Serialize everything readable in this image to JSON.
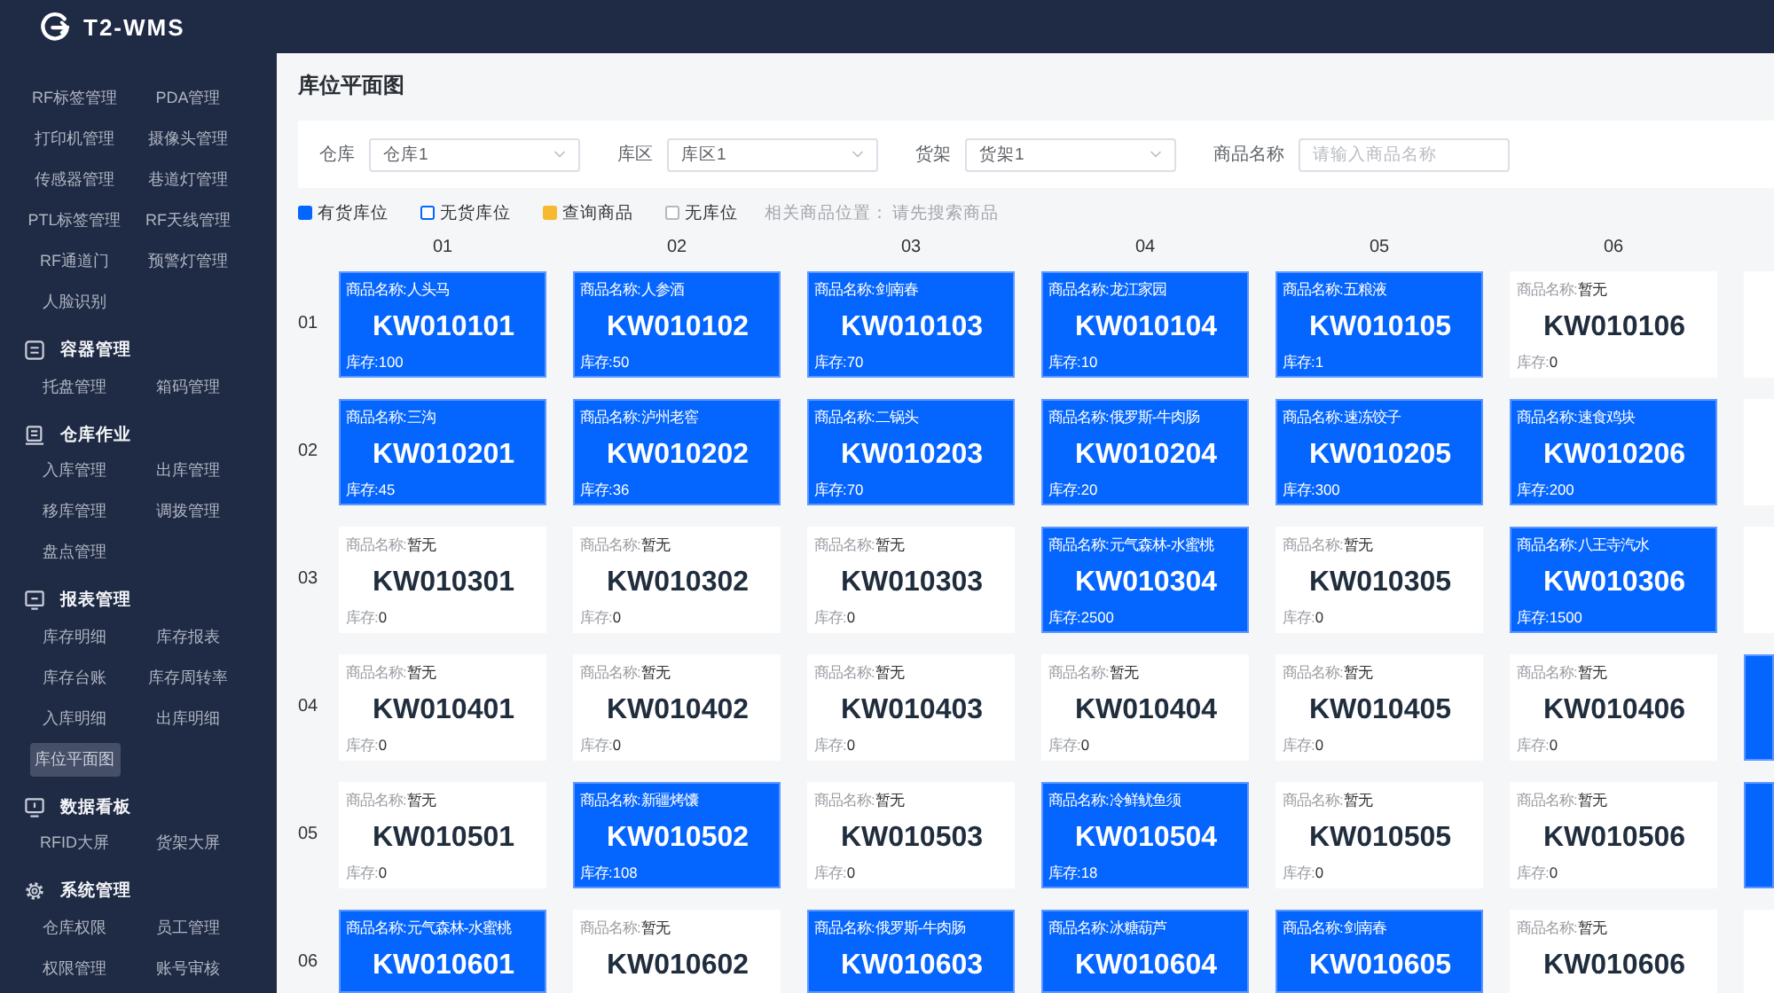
{
  "header": {
    "app_name": "T2-WMS"
  },
  "sidebar": {
    "groups": [
      {
        "items": [
          {
            "label": "RF标签管理",
            "selected": false
          },
          {
            "label": "PDA管理",
            "selected": false
          },
          {
            "label": "打印机管理",
            "selected": false
          },
          {
            "label": "摄像头管理",
            "selected": false
          },
          {
            "label": "传感器管理",
            "selected": false
          },
          {
            "label": "巷道灯管理",
            "selected": false
          },
          {
            "label": "PTL标签管理",
            "selected": false
          },
          {
            "label": "RF天线管理",
            "selected": false
          },
          {
            "label": "RF通道门",
            "selected": false
          },
          {
            "label": "预警灯管理",
            "selected": false
          },
          {
            "label": "人脸识别",
            "selected": false
          }
        ]
      },
      {
        "title": "容器管理",
        "items": [
          {
            "label": "托盘管理",
            "selected": false
          },
          {
            "label": "箱码管理",
            "selected": false
          }
        ]
      },
      {
        "title": "仓库作业",
        "items": [
          {
            "label": "入库管理",
            "selected": false
          },
          {
            "label": "出库管理",
            "selected": false
          },
          {
            "label": "移库管理",
            "selected": false
          },
          {
            "label": "调拨管理",
            "selected": false
          },
          {
            "label": "盘点管理",
            "selected": false
          }
        ]
      },
      {
        "title": "报表管理",
        "items": [
          {
            "label": "库存明细",
            "selected": false
          },
          {
            "label": "库存报表",
            "selected": false
          },
          {
            "label": "库存台账",
            "selected": false
          },
          {
            "label": "库存周转率",
            "selected": false
          },
          {
            "label": "入库明细",
            "selected": false
          },
          {
            "label": "出库明细",
            "selected": false
          },
          {
            "label": "库位平面图",
            "selected": true
          }
        ]
      },
      {
        "title": "数据看板",
        "items": [
          {
            "label": "RFID大屏",
            "selected": false
          },
          {
            "label": "货架大屏",
            "selected": false
          }
        ]
      },
      {
        "title": "系统管理",
        "items": [
          {
            "label": "仓库权限",
            "selected": false
          },
          {
            "label": "员工管理",
            "selected": false
          },
          {
            "label": "权限管理",
            "selected": false
          },
          {
            "label": "账号审核",
            "selected": false
          }
        ]
      }
    ]
  },
  "page_title": "库位平面图",
  "filters": [
    {
      "kind": "select",
      "label": "仓库",
      "value": "仓库1"
    },
    {
      "kind": "select",
      "label": "库区",
      "value": "库区1"
    },
    {
      "kind": "select",
      "label": "货架",
      "value": "货架1"
    },
    {
      "kind": "text",
      "label": "商品名称",
      "placeholder": "请输入商品名称"
    }
  ],
  "legend": [
    {
      "kind": "stocked",
      "label": "有货库位"
    },
    {
      "kind": "empty",
      "label": "无货库位"
    },
    {
      "kind": "queried",
      "label": "查询商品"
    },
    {
      "kind": "none",
      "label": "无库位"
    }
  ],
  "related": {
    "label": "相关商品位置：",
    "value": "请先搜索商品"
  },
  "grid": {
    "columns": [
      "01",
      "02",
      "03",
      "04",
      "05",
      "06"
    ],
    "rows": [
      {
        "label": "01",
        "cells": [
          {
            "name_label": "商品名称:",
            "name": "人头马",
            "code": "KW010101",
            "stock_label": "库存:",
            "stock": "100",
            "stocked": true
          },
          {
            "name_label": "商品名称:",
            "name": "人参酒",
            "code": "KW010102",
            "stock_label": "库存:",
            "stock": "50",
            "stocked": true
          },
          {
            "name_label": "商品名称:",
            "name": "剑南春",
            "code": "KW010103",
            "stock_label": "库存:",
            "stock": "70",
            "stocked": true
          },
          {
            "name_label": "商品名称:",
            "name": "龙江家园",
            "code": "KW010104",
            "stock_label": "库存:",
            "stock": "10",
            "stocked": true
          },
          {
            "name_label": "商品名称:",
            "name": "五粮液",
            "code": "KW010105",
            "stock_label": "库存:",
            "stock": "1",
            "stocked": true
          },
          {
            "name_label": "商品名称:",
            "name": "暂无",
            "code": "KW010106",
            "stock_label": "库存:",
            "stock": "0",
            "stocked": false
          }
        ],
        "cut_cell": {
          "stocked": false
        }
      },
      {
        "label": "02",
        "cells": [
          {
            "name_label": "商品名称:",
            "name": "三沟",
            "code": "KW010201",
            "stock_label": "库存:",
            "stock": "45",
            "stocked": true
          },
          {
            "name_label": "商品名称:",
            "name": "泸州老窖",
            "code": "KW010202",
            "stock_label": "库存:",
            "stock": "36",
            "stocked": true
          },
          {
            "name_label": "商品名称:",
            "name": "二锅头",
            "code": "KW010203",
            "stock_label": "库存:",
            "stock": "70",
            "stocked": true
          },
          {
            "name_label": "商品名称:",
            "name": "俄罗斯-牛肉肠",
            "code": "KW010204",
            "stock_label": "库存:",
            "stock": "20",
            "stocked": true
          },
          {
            "name_label": "商品名称:",
            "name": "速冻饺子",
            "code": "KW010205",
            "stock_label": "库存:",
            "stock": "300",
            "stocked": true
          },
          {
            "name_label": "商品名称:",
            "name": "速食鸡块",
            "code": "KW010206",
            "stock_label": "库存:",
            "stock": "200",
            "stocked": true
          }
        ],
        "cut_cell": {
          "stocked": false
        }
      },
      {
        "label": "03",
        "cells": [
          {
            "name_label": "商品名称:",
            "name": "暂无",
            "code": "KW010301",
            "stock_label": "库存:",
            "stock": "0",
            "stocked": false
          },
          {
            "name_label": "商品名称:",
            "name": "暂无",
            "code": "KW010302",
            "stock_label": "库存:",
            "stock": "0",
            "stocked": false
          },
          {
            "name_label": "商品名称:",
            "name": "暂无",
            "code": "KW010303",
            "stock_label": "库存:",
            "stock": "0",
            "stocked": false
          },
          {
            "name_label": "商品名称:",
            "name": "元气森林-水蜜桃",
            "code": "KW010304",
            "stock_label": "库存:",
            "stock": "2500",
            "stocked": true
          },
          {
            "name_label": "商品名称:",
            "name": "暂无",
            "code": "KW010305",
            "stock_label": "库存:",
            "stock": "0",
            "stocked": false
          },
          {
            "name_label": "商品名称:",
            "name": "八王寺汽水",
            "code": "KW010306",
            "stock_label": "库存:",
            "stock": "1500",
            "stocked": true
          }
        ],
        "cut_cell": {
          "stocked": false
        }
      },
      {
        "label": "04",
        "cells": [
          {
            "name_label": "商品名称:",
            "name": "暂无",
            "code": "KW010401",
            "stock_label": "库存:",
            "stock": "0",
            "stocked": false
          },
          {
            "name_label": "商品名称:",
            "name": "暂无",
            "code": "KW010402",
            "stock_label": "库存:",
            "stock": "0",
            "stocked": false
          },
          {
            "name_label": "商品名称:",
            "name": "暂无",
            "code": "KW010403",
            "stock_label": "库存:",
            "stock": "0",
            "stocked": false
          },
          {
            "name_label": "商品名称:",
            "name": "暂无",
            "code": "KW010404",
            "stock_label": "库存:",
            "stock": "0",
            "stocked": false
          },
          {
            "name_label": "商品名称:",
            "name": "暂无",
            "code": "KW010405",
            "stock_label": "库存:",
            "stock": "0",
            "stocked": false
          },
          {
            "name_label": "商品名称:",
            "name": "暂无",
            "code": "KW010406",
            "stock_label": "库存:",
            "stock": "0",
            "stocked": false
          }
        ],
        "cut_cell": {
          "stocked": true
        }
      },
      {
        "label": "05",
        "cells": [
          {
            "name_label": "商品名称:",
            "name": "暂无",
            "code": "KW010501",
            "stock_label": "库存:",
            "stock": "0",
            "stocked": false
          },
          {
            "name_label": "商品名称:",
            "name": "新疆烤馕",
            "code": "KW010502",
            "stock_label": "库存:",
            "stock": "108",
            "stocked": true
          },
          {
            "name_label": "商品名称:",
            "name": "暂无",
            "code": "KW010503",
            "stock_label": "库存:",
            "stock": "0",
            "stocked": false
          },
          {
            "name_label": "商品名称:",
            "name": "冷鲜鱿鱼须",
            "code": "KW010504",
            "stock_label": "库存:",
            "stock": "18",
            "stocked": true
          },
          {
            "name_label": "商品名称:",
            "name": "暂无",
            "code": "KW010505",
            "stock_label": "库存:",
            "stock": "0",
            "stocked": false
          },
          {
            "name_label": "商品名称:",
            "name": "暂无",
            "code": "KW010506",
            "stock_label": "库存:",
            "stock": "0",
            "stocked": false
          }
        ],
        "cut_cell": {
          "stocked": true
        }
      },
      {
        "label": "06",
        "cells": [
          {
            "name_label": "商品名称:",
            "name": "元气森林-水蜜桃",
            "code": "KW010601",
            "stocked": true
          },
          {
            "name_label": "商品名称:",
            "name": "暂无",
            "code": "KW010602",
            "stocked": false
          },
          {
            "name_label": "商品名称:",
            "name": "俄罗斯-牛肉肠",
            "code": "KW010603",
            "stocked": true
          },
          {
            "name_label": "商品名称:",
            "name": "冰糖葫芦",
            "code": "KW010604",
            "stocked": true
          },
          {
            "name_label": "商品名称:",
            "name": "剑南春",
            "code": "KW010605",
            "stocked": true
          },
          {
            "name_label": "商品名称:",
            "name": "暂无",
            "code": "KW010606",
            "stocked": false
          }
        ],
        "cut_cell": {
          "stocked": false
        }
      }
    ]
  }
}
